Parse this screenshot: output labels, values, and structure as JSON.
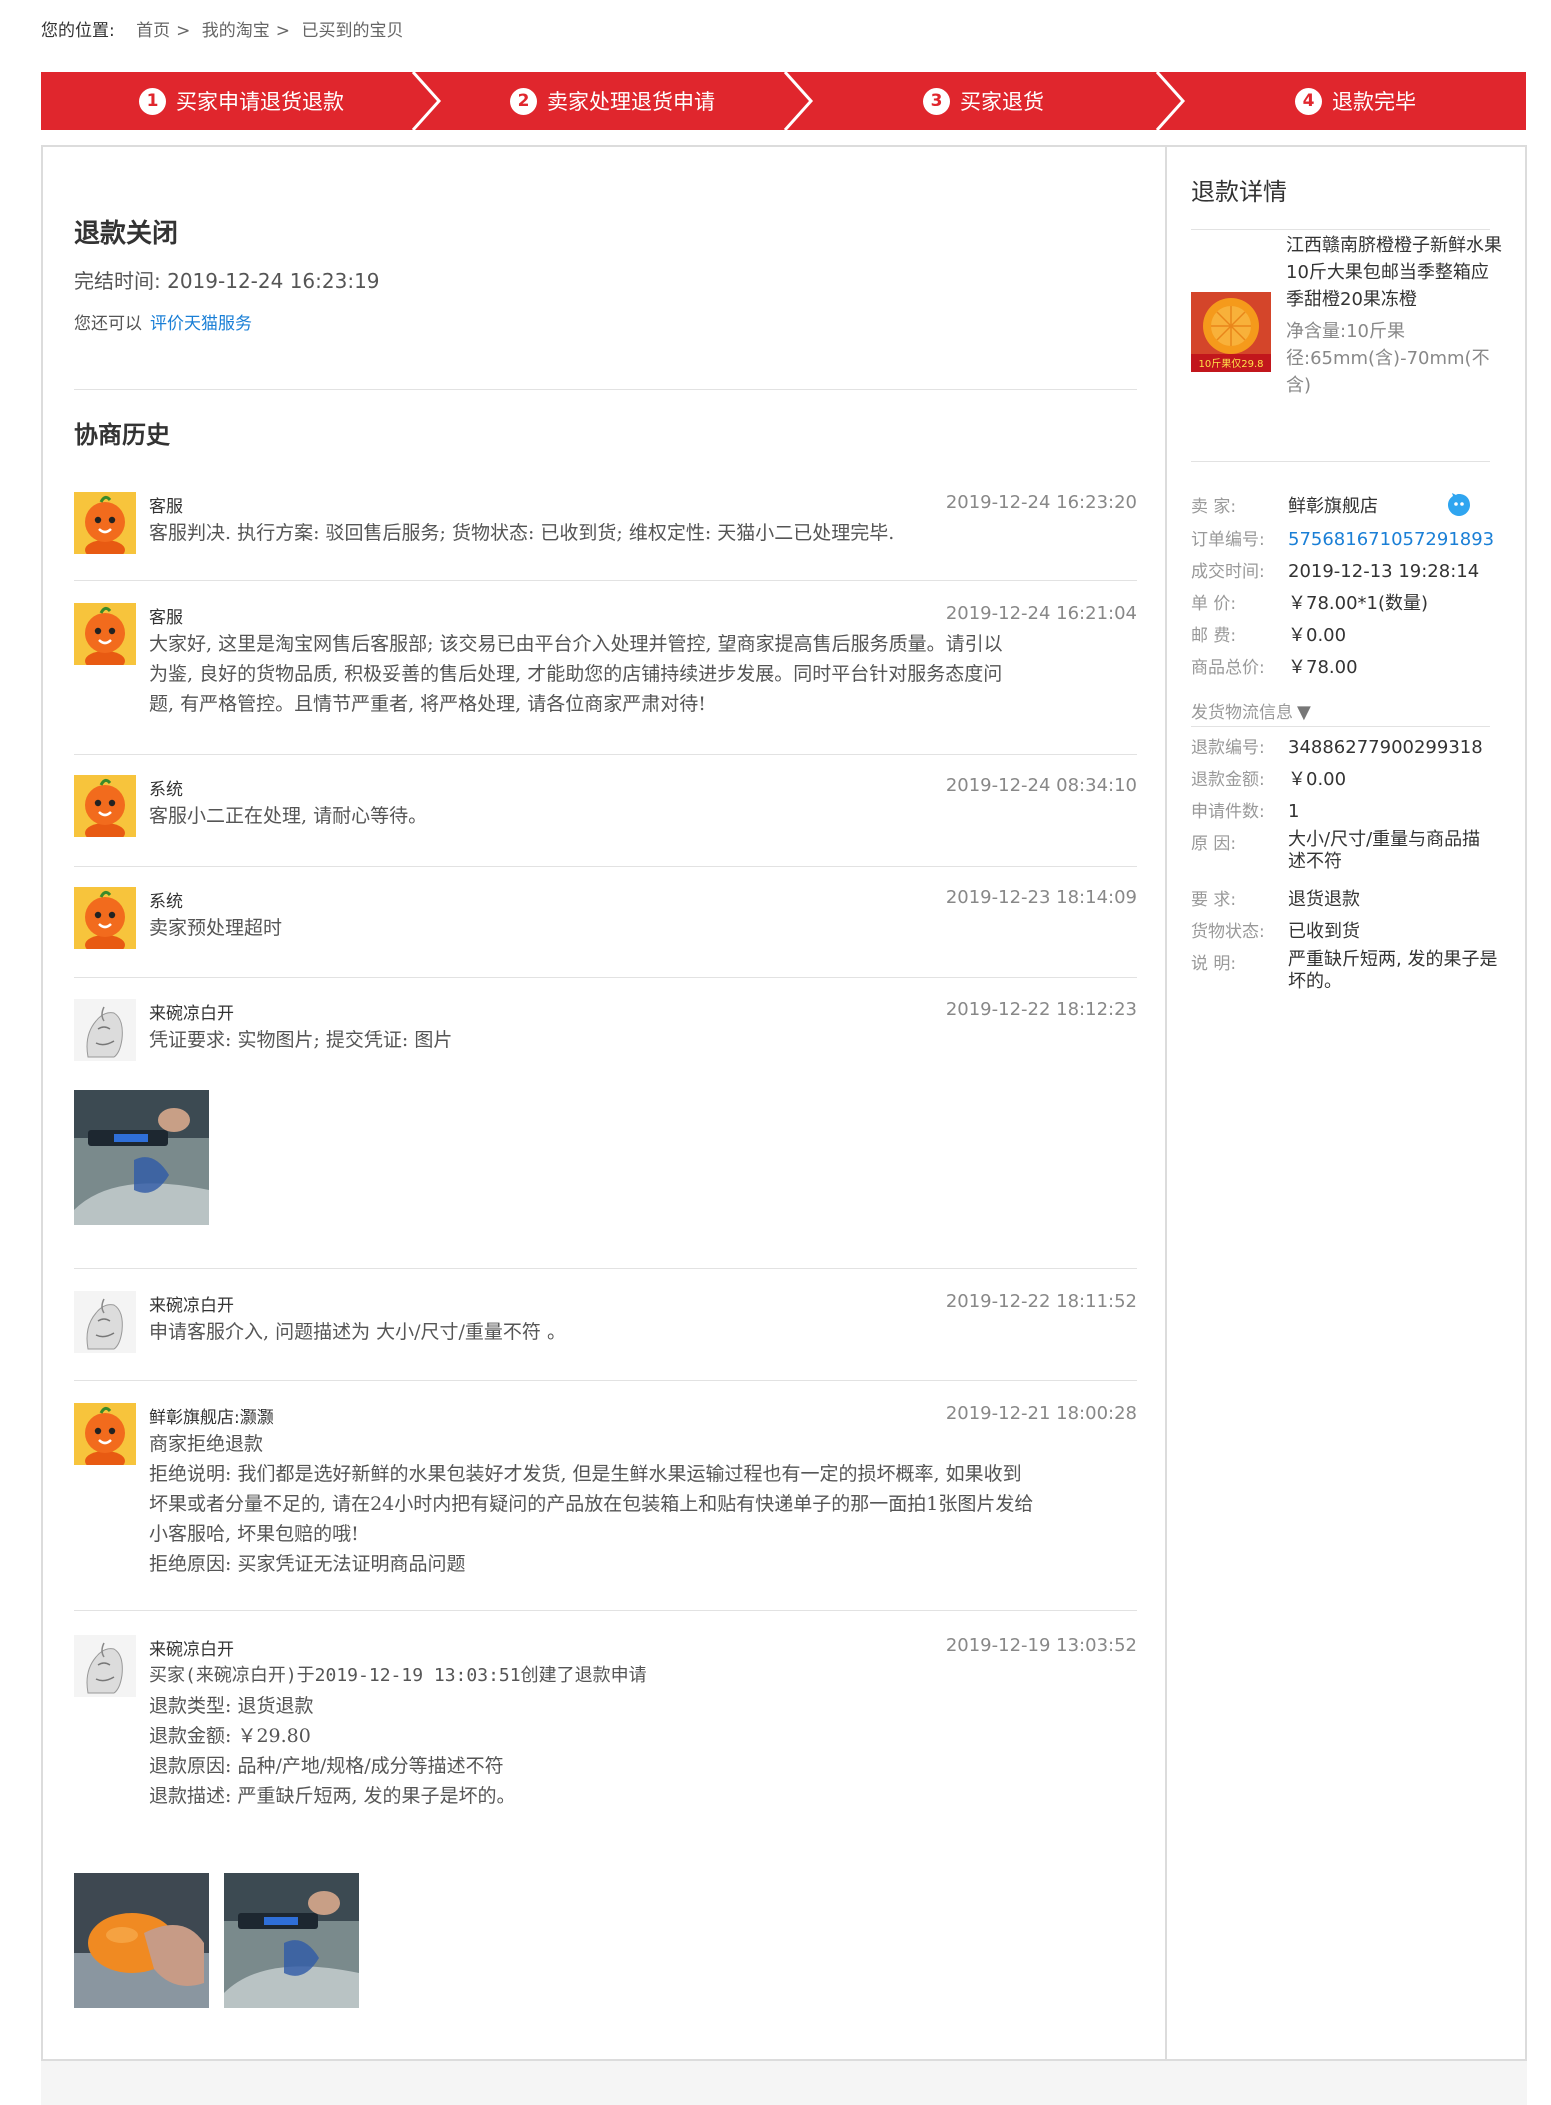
{
  "breadcrumb": {
    "label": "您的位置:",
    "items": [
      "首页",
      "我的淘宝",
      "已买到的宝贝"
    ],
    "separator": ">"
  },
  "steps": [
    {
      "num": "1",
      "label": "买家申请退货退款"
    },
    {
      "num": "2",
      "label": "卖家处理退货申请"
    },
    {
      "num": "3",
      "label": "买家退货"
    },
    {
      "num": "4",
      "label": "退款完毕"
    }
  ],
  "status": {
    "title": "退款关闭",
    "finish_label": "完结时间:",
    "finish_time": "2019-12-24 16:23:19",
    "also_label": "您还可以",
    "rate_link": "评价天猫服务"
  },
  "history": {
    "title": "协商历史",
    "messages": [
      {
        "name": "客服",
        "time": "2019-12-24 16:23:20",
        "avatar": "tmall-mascot",
        "lines": [
          "客服判决. 执行方案: 驳回售后服务; 货物状态: 已收到货; 维权定性: 天猫小二已处理完毕."
        ]
      },
      {
        "name": "客服",
        "time": "2019-12-24 16:21:04",
        "avatar": "tmall-mascot",
        "lines": [
          " 大家好, 这里是淘宝网售后客服部; 该交易已由平台介入处理并管控, 望商家提高售后服务质量。请引以",
          "为鉴, 良好的货物品质, 积极妥善的售后处理, 才能助您的店铺持续进步发展。同时平台针对服务态度问",
          "题, 有严格管控。且情节严重者, 将严格处理, 请各位商家严肃对待!"
        ]
      },
      {
        "name": "系统",
        "time": "2019-12-24 08:34:10",
        "avatar": "tmall-mascot",
        "lines": [
          "客服小二正在处理, 请耐心等待。"
        ]
      },
      {
        "name": "系统",
        "time": "2019-12-23 18:14:09",
        "avatar": "tmall-mascot",
        "lines": [
          "卖家预处理超时"
        ]
      },
      {
        "name": "来碗凉白开",
        "time": "2019-12-22 18:12:23",
        "avatar": "buyer-sketch",
        "lines": [
          "凭证要求: 实物图片; 提交凭证: 图片"
        ]
      },
      {
        "name": "来碗凉白开",
        "time": "2019-12-22 18:11:52",
        "avatar": "buyer-sketch",
        "lines": [
          "申请客服介入, 问题描述为 大小/尺寸/重量不符 。"
        ]
      },
      {
        "name": "鲜彰旗舰店:灏灏",
        "time": "2019-12-21 18:00:28",
        "avatar": "tmall-mascot",
        "lines": [
          "商家拒绝退款",
          "拒绝说明: 我们都是选好新鲜的水果包装好才发货, 但是生鲜水果运输过程也有一定的损坏概率, 如果收到",
          "坏果或者分量不足的, 请在24小时内把有疑问的产品放在包装箱上和贴有快递单子的那一面拍1张图片发给",
          "小客服哈, 坏果包赔的哦!",
          "拒绝原因: 买家凭证无法证明商品问题"
        ]
      },
      {
        "name": "来碗凉白开",
        "time": "2019-12-19 13:03:52",
        "avatar": "buyer-sketch",
        "lines": [
          "买家(来碗凉白开)于2019-12-19 13:03:51创建了退款申请",
          "退款类型: 退货退款",
          "退款金额: ￥29.80",
          "退款原因: 品种/产地/规格/成分等描述不符",
          "退款描述: 严重缺斤短两, 发的果子是坏的。"
        ]
      }
    ]
  },
  "detail": {
    "title": "退款详情",
    "product_title": "江西赣南脐橙橙子新鲜水果10斤大果包邮当季整箱应季甜橙20果冻橙",
    "product_spec": "净含量:10斤果径:65mm(含)-70mm(不含)",
    "product_img_text": "10斤果仅29.8",
    "seller_label": "卖 家:",
    "seller": "鲜彰旗舰店",
    "order_label": "订单编号:",
    "order_no": "575681671057291893",
    "deal_time_label": "成交时间:",
    "deal_time": "2019-12-13 19:28:14",
    "price_label": "单 价:",
    "price": "￥78.00*1(数量)",
    "postage_label": "邮 费:",
    "postage": "￥0.00",
    "total_label": "商品总价:",
    "total": "￥78.00",
    "logistics_label": "发货物流信息",
    "refund_no_label": "退款编号:",
    "refund_no": "34886277900299318",
    "refund_amount_label": "退款金额:",
    "refund_amount": "￥0.00",
    "apply_count_label": "申请件数:",
    "apply_count": "1",
    "reason_label": "原 因:",
    "reason": "大小/尺寸/重量与商品描述不符",
    "request_label": "要 求:",
    "request": "退货退款",
    "goods_status_label": "货物状态:",
    "goods_status": "已收到货",
    "note_label": "说 明:",
    "note": "严重缺斤短两, 发的果子是坏的。"
  },
  "colors": {
    "brand_red": "#e0262d",
    "link_blue": "#1a7fd6",
    "border": "#dcdcdc"
  }
}
